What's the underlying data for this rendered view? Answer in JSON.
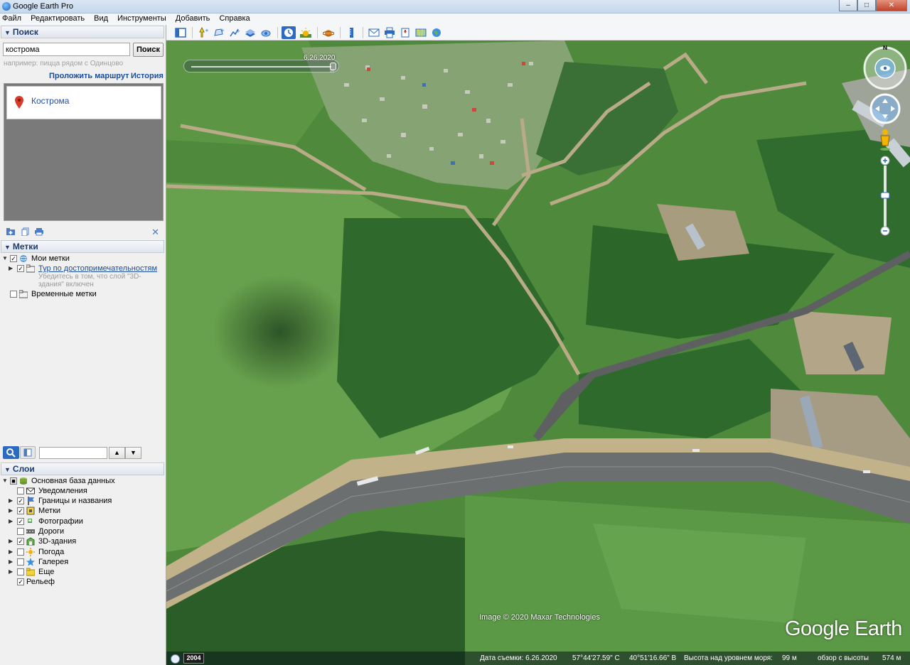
{
  "window": {
    "title": "Google Earth Pro",
    "minimize": "–",
    "maximize": "□",
    "close": "✕"
  },
  "menu": [
    "Файл",
    "Редактировать",
    "Вид",
    "Инструменты",
    "Добавить",
    "Справка"
  ],
  "search": {
    "header": "Поиск",
    "value": "кострома",
    "button": "Поиск",
    "hint": "например: пицца рядом с Одинцово",
    "route_link": "Проложить маршрут",
    "history_link": "История",
    "results": [
      "Кострома"
    ]
  },
  "places": {
    "header": "Метки",
    "my_places": "Мои метки",
    "tour": "Тур по достопримечательностям",
    "tour_note": "Убедитесь в том, что слой \"3D-здания\" включен",
    "temp_places": "Временные метки"
  },
  "layers": {
    "header": "Слои",
    "primary": "Основная база данных",
    "items": [
      {
        "label": "Уведомления",
        "checked": false,
        "icon": "envelope-icon"
      },
      {
        "label": "Границы и названия",
        "checked": true,
        "icon": "borders-icon"
      },
      {
        "label": "Метки",
        "checked": true,
        "icon": "places-icon"
      },
      {
        "label": "Фотографии",
        "checked": true,
        "icon": "photos-icon"
      },
      {
        "label": "Дороги",
        "checked": false,
        "icon": "roads-icon"
      },
      {
        "label": "3D-здания",
        "checked": true,
        "icon": "buildings-3d-icon"
      },
      {
        "label": "Погода",
        "checked": false,
        "icon": "weather-icon"
      },
      {
        "label": "Галерея",
        "checked": false,
        "icon": "gallery-star-icon"
      },
      {
        "label": "Еще",
        "checked": false,
        "icon": "more-folder-icon"
      }
    ],
    "terrain": "Рельеф"
  },
  "map": {
    "time_label": "6.26.2020",
    "attribution": "Image © 2020 Maxar Technologies",
    "logo": "Google Earth",
    "year_badge": "2004",
    "north": "N",
    "status": {
      "date": "Дата съемки: 6.26.2020",
      "lat": "57°44'27.59\" С",
      "lon": "40°51'16.66\" В",
      "elevation": "Высота над уровнем моря:",
      "elevation_value": "99 м",
      "eye_alt": "обзор с высоты",
      "eye_alt_value": "574 м"
    }
  },
  "colors": {
    "accent": "#2d6bc2",
    "link": "#1a4d9c",
    "header_text": "#1c3b6e"
  }
}
